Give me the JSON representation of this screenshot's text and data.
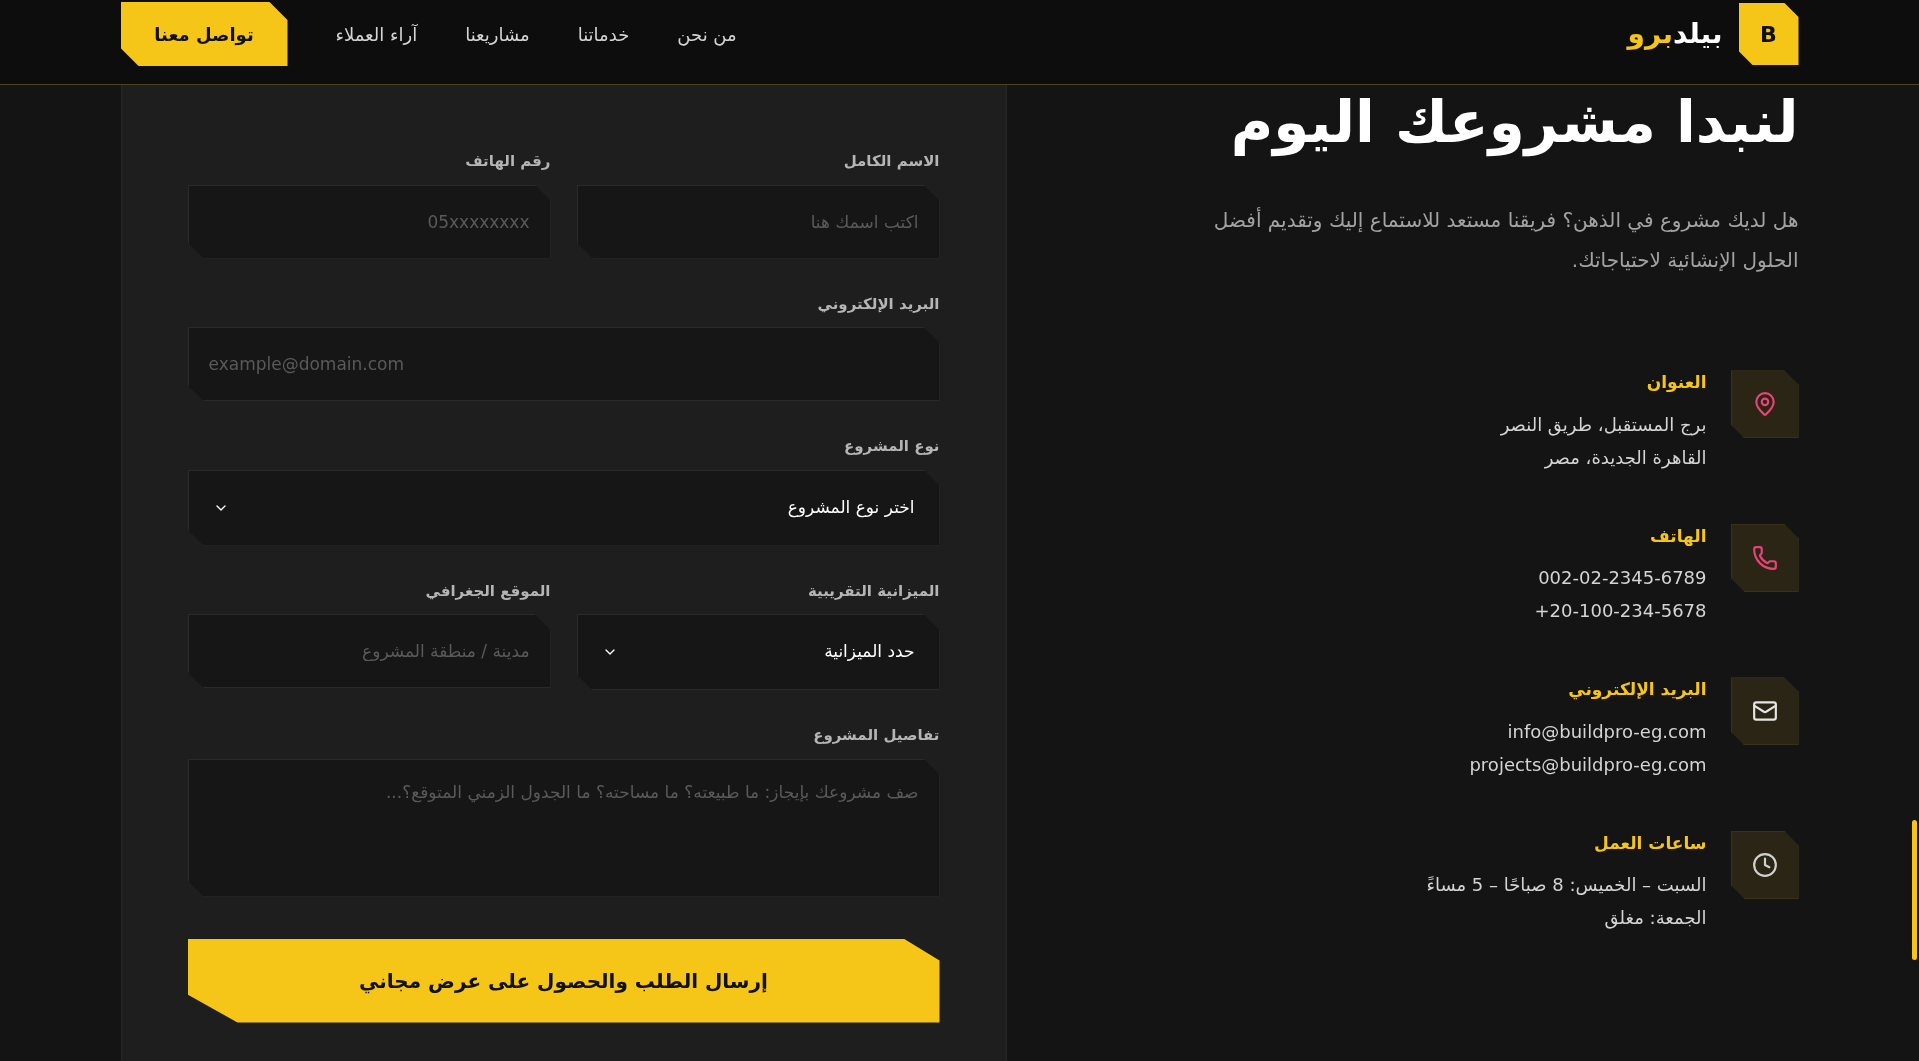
{
  "header": {
    "logo": {
      "letter": "B",
      "text_main": "بيلد",
      "text_accent": "برو"
    },
    "nav": [
      {
        "label": "من نحن"
      },
      {
        "label": "خدماتنا"
      },
      {
        "label": "مشاريعنا"
      },
      {
        "label": "آراء العملاء"
      }
    ],
    "cta": "تواصل معنا"
  },
  "intro": {
    "title": "لنبدا مشروعك اليوم",
    "text": "هل لديك مشروع في الذهن؟ فريقنا مستعد للاستماع إليك وتقديم أفضل الحلول الإنشائية لاحتياجاتك."
  },
  "contacts": [
    {
      "kind": "pin",
      "title": "العنوان",
      "lines": [
        "برج المستقبل، طريق النصر",
        "القاهرة الجديدة، مصر"
      ]
    },
    {
      "kind": "phone",
      "title": "الهاتف",
      "lines": [
        "002-02-2345-6789",
        "20-100-234-5678+"
      ]
    },
    {
      "kind": "mail",
      "title": "البريد الإلكتروني",
      "lines": [
        "info@buildpro-eg.com",
        "projects@buildpro-eg.com"
      ]
    },
    {
      "kind": "clock",
      "title": "ساعات العمل",
      "lines": [
        "السبت – الخميس: 8 صباحًا – 5 مساءً",
        "الجمعة: مغلق"
      ]
    }
  ],
  "form": {
    "rows": [
      [
        {
          "kind": "text",
          "label": "الاسم الكامل",
          "placeholder": "اكتب اسمك هنا"
        },
        {
          "kind": "text",
          "label": "رقم الهاتف",
          "placeholder": "05xxxxxxxx"
        }
      ],
      [
        {
          "kind": "email",
          "label": "البريد الإلكتروني",
          "placeholder": "example@domain.com"
        }
      ],
      [
        {
          "kind": "select",
          "label": "نوع المشروع",
          "value": "اختر نوع المشروع"
        }
      ],
      [
        {
          "kind": "select",
          "label": "الميزانية التقريبية",
          "value": "حدد الميزانية"
        },
        {
          "kind": "text",
          "label": "الموقع الجغرافي",
          "placeholder": "مدينة / منطقة المشروع"
        }
      ],
      [
        {
          "kind": "textarea",
          "label": "تفاصيل المشروع",
          "placeholder": "صف مشروعك بإيجاز: ما طبيعته؟ ما مساحته؟ ما الجدول الزمني المتوقع؟..."
        }
      ]
    ],
    "submit": "إرسال الطلب والحصول على عرض مجاني"
  }
}
